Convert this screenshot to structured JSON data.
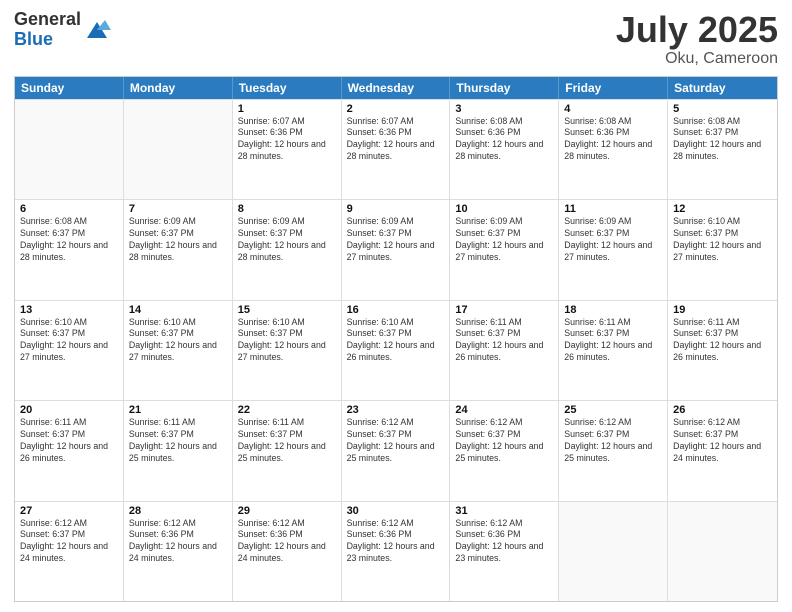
{
  "logo": {
    "general": "General",
    "blue": "Blue"
  },
  "header": {
    "month": "July 2025",
    "location": "Oku, Cameroon"
  },
  "weekdays": [
    "Sunday",
    "Monday",
    "Tuesday",
    "Wednesday",
    "Thursday",
    "Friday",
    "Saturday"
  ],
  "weeks": [
    [
      {
        "day": "",
        "sunrise": "",
        "sunset": "",
        "daylight": "",
        "empty": true
      },
      {
        "day": "",
        "sunrise": "",
        "sunset": "",
        "daylight": "",
        "empty": true
      },
      {
        "day": "1",
        "sunrise": "Sunrise: 6:07 AM",
        "sunset": "Sunset: 6:36 PM",
        "daylight": "Daylight: 12 hours and 28 minutes.",
        "empty": false
      },
      {
        "day": "2",
        "sunrise": "Sunrise: 6:07 AM",
        "sunset": "Sunset: 6:36 PM",
        "daylight": "Daylight: 12 hours and 28 minutes.",
        "empty": false
      },
      {
        "day": "3",
        "sunrise": "Sunrise: 6:08 AM",
        "sunset": "Sunset: 6:36 PM",
        "daylight": "Daylight: 12 hours and 28 minutes.",
        "empty": false
      },
      {
        "day": "4",
        "sunrise": "Sunrise: 6:08 AM",
        "sunset": "Sunset: 6:36 PM",
        "daylight": "Daylight: 12 hours and 28 minutes.",
        "empty": false
      },
      {
        "day": "5",
        "sunrise": "Sunrise: 6:08 AM",
        "sunset": "Sunset: 6:37 PM",
        "daylight": "Daylight: 12 hours and 28 minutes.",
        "empty": false
      }
    ],
    [
      {
        "day": "6",
        "sunrise": "Sunrise: 6:08 AM",
        "sunset": "Sunset: 6:37 PM",
        "daylight": "Daylight: 12 hours and 28 minutes.",
        "empty": false
      },
      {
        "day": "7",
        "sunrise": "Sunrise: 6:09 AM",
        "sunset": "Sunset: 6:37 PM",
        "daylight": "Daylight: 12 hours and 28 minutes.",
        "empty": false
      },
      {
        "day": "8",
        "sunrise": "Sunrise: 6:09 AM",
        "sunset": "Sunset: 6:37 PM",
        "daylight": "Daylight: 12 hours and 28 minutes.",
        "empty": false
      },
      {
        "day": "9",
        "sunrise": "Sunrise: 6:09 AM",
        "sunset": "Sunset: 6:37 PM",
        "daylight": "Daylight: 12 hours and 27 minutes.",
        "empty": false
      },
      {
        "day": "10",
        "sunrise": "Sunrise: 6:09 AM",
        "sunset": "Sunset: 6:37 PM",
        "daylight": "Daylight: 12 hours and 27 minutes.",
        "empty": false
      },
      {
        "day": "11",
        "sunrise": "Sunrise: 6:09 AM",
        "sunset": "Sunset: 6:37 PM",
        "daylight": "Daylight: 12 hours and 27 minutes.",
        "empty": false
      },
      {
        "day": "12",
        "sunrise": "Sunrise: 6:10 AM",
        "sunset": "Sunset: 6:37 PM",
        "daylight": "Daylight: 12 hours and 27 minutes.",
        "empty": false
      }
    ],
    [
      {
        "day": "13",
        "sunrise": "Sunrise: 6:10 AM",
        "sunset": "Sunset: 6:37 PM",
        "daylight": "Daylight: 12 hours and 27 minutes.",
        "empty": false
      },
      {
        "day": "14",
        "sunrise": "Sunrise: 6:10 AM",
        "sunset": "Sunset: 6:37 PM",
        "daylight": "Daylight: 12 hours and 27 minutes.",
        "empty": false
      },
      {
        "day": "15",
        "sunrise": "Sunrise: 6:10 AM",
        "sunset": "Sunset: 6:37 PM",
        "daylight": "Daylight: 12 hours and 27 minutes.",
        "empty": false
      },
      {
        "day": "16",
        "sunrise": "Sunrise: 6:10 AM",
        "sunset": "Sunset: 6:37 PM",
        "daylight": "Daylight: 12 hours and 26 minutes.",
        "empty": false
      },
      {
        "day": "17",
        "sunrise": "Sunrise: 6:11 AM",
        "sunset": "Sunset: 6:37 PM",
        "daylight": "Daylight: 12 hours and 26 minutes.",
        "empty": false
      },
      {
        "day": "18",
        "sunrise": "Sunrise: 6:11 AM",
        "sunset": "Sunset: 6:37 PM",
        "daylight": "Daylight: 12 hours and 26 minutes.",
        "empty": false
      },
      {
        "day": "19",
        "sunrise": "Sunrise: 6:11 AM",
        "sunset": "Sunset: 6:37 PM",
        "daylight": "Daylight: 12 hours and 26 minutes.",
        "empty": false
      }
    ],
    [
      {
        "day": "20",
        "sunrise": "Sunrise: 6:11 AM",
        "sunset": "Sunset: 6:37 PM",
        "daylight": "Daylight: 12 hours and 26 minutes.",
        "empty": false
      },
      {
        "day": "21",
        "sunrise": "Sunrise: 6:11 AM",
        "sunset": "Sunset: 6:37 PM",
        "daylight": "Daylight: 12 hours and 25 minutes.",
        "empty": false
      },
      {
        "day": "22",
        "sunrise": "Sunrise: 6:11 AM",
        "sunset": "Sunset: 6:37 PM",
        "daylight": "Daylight: 12 hours and 25 minutes.",
        "empty": false
      },
      {
        "day": "23",
        "sunrise": "Sunrise: 6:12 AM",
        "sunset": "Sunset: 6:37 PM",
        "daylight": "Daylight: 12 hours and 25 minutes.",
        "empty": false
      },
      {
        "day": "24",
        "sunrise": "Sunrise: 6:12 AM",
        "sunset": "Sunset: 6:37 PM",
        "daylight": "Daylight: 12 hours and 25 minutes.",
        "empty": false
      },
      {
        "day": "25",
        "sunrise": "Sunrise: 6:12 AM",
        "sunset": "Sunset: 6:37 PM",
        "daylight": "Daylight: 12 hours and 25 minutes.",
        "empty": false
      },
      {
        "day": "26",
        "sunrise": "Sunrise: 6:12 AM",
        "sunset": "Sunset: 6:37 PM",
        "daylight": "Daylight: 12 hours and 24 minutes.",
        "empty": false
      }
    ],
    [
      {
        "day": "27",
        "sunrise": "Sunrise: 6:12 AM",
        "sunset": "Sunset: 6:37 PM",
        "daylight": "Daylight: 12 hours and 24 minutes.",
        "empty": false
      },
      {
        "day": "28",
        "sunrise": "Sunrise: 6:12 AM",
        "sunset": "Sunset: 6:36 PM",
        "daylight": "Daylight: 12 hours and 24 minutes.",
        "empty": false
      },
      {
        "day": "29",
        "sunrise": "Sunrise: 6:12 AM",
        "sunset": "Sunset: 6:36 PM",
        "daylight": "Daylight: 12 hours and 24 minutes.",
        "empty": false
      },
      {
        "day": "30",
        "sunrise": "Sunrise: 6:12 AM",
        "sunset": "Sunset: 6:36 PM",
        "daylight": "Daylight: 12 hours and 23 minutes.",
        "empty": false
      },
      {
        "day": "31",
        "sunrise": "Sunrise: 6:12 AM",
        "sunset": "Sunset: 6:36 PM",
        "daylight": "Daylight: 12 hours and 23 minutes.",
        "empty": false
      },
      {
        "day": "",
        "sunrise": "",
        "sunset": "",
        "daylight": "",
        "empty": true
      },
      {
        "day": "",
        "sunrise": "",
        "sunset": "",
        "daylight": "",
        "empty": true
      }
    ]
  ]
}
